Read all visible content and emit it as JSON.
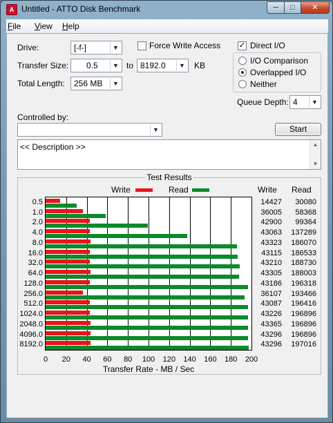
{
  "window": {
    "title": "Untitled - ATTO Disk Benchmark",
    "app_icon": "A",
    "min_glyph": "─",
    "max_glyph": "□",
    "close_glyph": "✕"
  },
  "menu": [
    {
      "underline": "F",
      "rest": "ile"
    },
    {
      "underline": "V",
      "rest": "iew"
    },
    {
      "underline": "H",
      "rest": "elp"
    }
  ],
  "form": {
    "drive_label": "Drive:",
    "drive_value": "[-f-]",
    "transfer_size_label": "Transfer Size:",
    "transfer_from": "0.5",
    "to_label": "to",
    "transfer_to": "8192.0",
    "kb_label": "KB",
    "total_length_label": "Total Length:",
    "total_length_value": "256 MB",
    "force_write_label": "Force Write Access",
    "force_write_checked": false,
    "direct_io_label": "Direct I/O",
    "direct_io_checked": true,
    "io_comparison_label": "I/O Comparison",
    "overlapped_io_label": "Overlapped I/O",
    "neither_label": "Neither",
    "io_mode_selected": "overlapped",
    "queue_depth_label": "Queue Depth:",
    "queue_depth_value": "4",
    "controlled_by_label": "Controlled by:",
    "controlled_by_value": "",
    "start_label": "Start",
    "description": "<< Description >>",
    "arrow_glyph": "▼",
    "check_glyph": "✓",
    "scroll_up_glyph": "▲",
    "scroll_down_glyph": "▼"
  },
  "results": {
    "title": "Test Results",
    "legend_write": "Write",
    "legend_read": "Read",
    "col_write": "Write",
    "col_read": "Read",
    "xlabel": "Transfer Rate - MB / Sec",
    "colors": {
      "write": "#e8151b",
      "read": "#0c8a2c"
    }
  },
  "chart_data": {
    "type": "bar",
    "orientation": "horizontal",
    "title": "Test Results",
    "xlabel": "Transfer Rate - MB / Sec",
    "xlim": [
      0,
      200
    ],
    "xticks": [
      0,
      20,
      40,
      60,
      80,
      100,
      120,
      140,
      160,
      180,
      200
    ],
    "grid": true,
    "legend": "top",
    "categories": [
      "0.5",
      "1.0",
      "2.0",
      "4.0",
      "8.0",
      "16.0",
      "32.0",
      "64.0",
      "128.0",
      "256.0",
      "512.0",
      "1024.0",
      "2048.0",
      "4096.0",
      "8192.0"
    ],
    "series": [
      {
        "name": "Write",
        "values": [
          14427,
          36005,
          42900,
          43063,
          43323,
          43115,
          43210,
          43305,
          43186,
          36107,
          43087,
          43226,
          43365,
          43296,
          43296
        ]
      },
      {
        "name": "Read",
        "values": [
          30080,
          58368,
          99364,
          137289,
          186070,
          186533,
          188730,
          188003,
          196318,
          193466,
          196416,
          196896,
          196896,
          196896,
          197016
        ]
      }
    ]
  }
}
